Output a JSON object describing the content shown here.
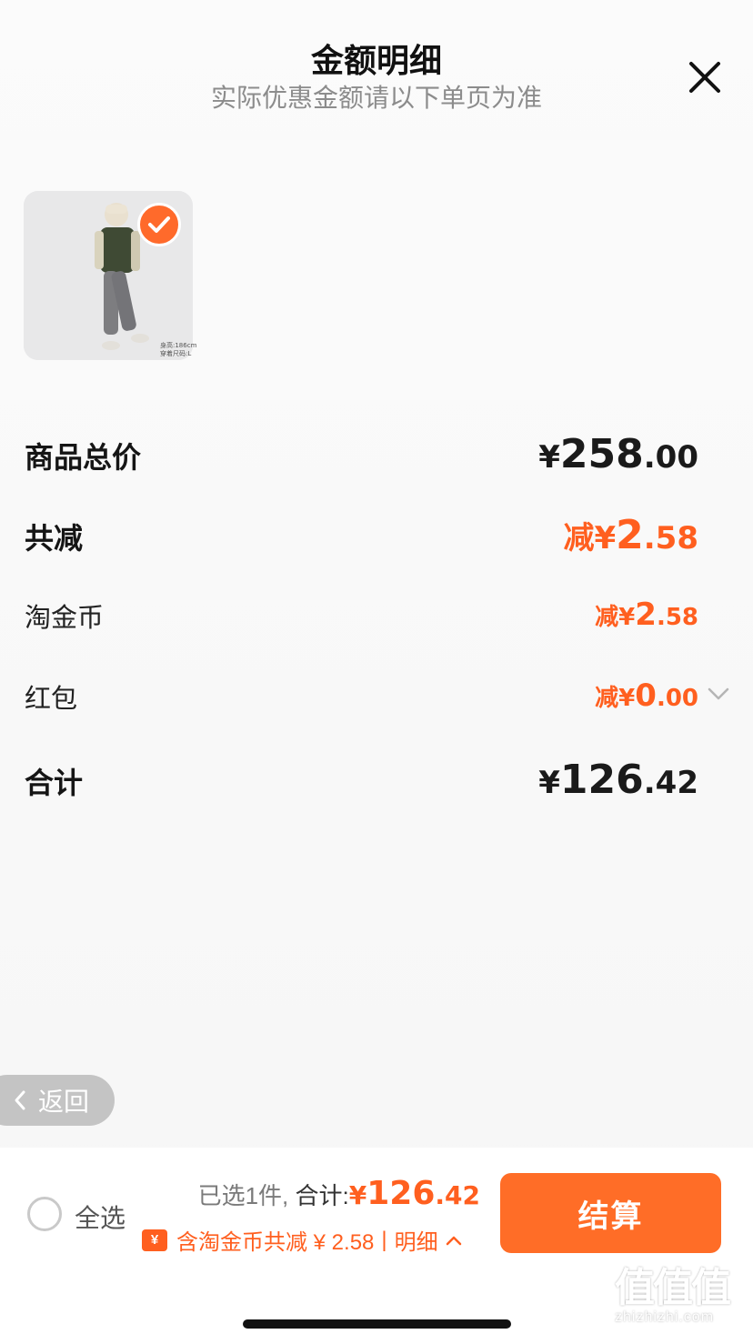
{
  "header": {
    "title": "金额明细",
    "subtitle": "实际优惠金额请以下单页为准"
  },
  "product": {
    "caption_line1": "身高:186cm",
    "caption_line2": "穿着尺码:L"
  },
  "rows": {
    "total_price": {
      "label": "商品总价",
      "yen": "¥",
      "int": "258",
      "dec": ".00"
    },
    "total_discount": {
      "label": "共减",
      "prefix": "减",
      "yen": "¥",
      "int": "2",
      "dec": ".58"
    },
    "taojinbi": {
      "label": "淘金币",
      "prefix": "减",
      "yen": "¥",
      "int": "2",
      "dec": ".58"
    },
    "red_packet": {
      "label": "红包",
      "prefix": "减",
      "yen": "¥",
      "int": "0",
      "dec": ".00"
    },
    "sum": {
      "label": "合计",
      "yen": "¥",
      "int": "126",
      "dec": ".42"
    }
  },
  "back_button": {
    "label": "返回"
  },
  "bottom_bar": {
    "select_all": "全选",
    "selected_text": "已选1件,",
    "total_label": "合计:",
    "total_yen": "¥",
    "total_int": "126",
    "total_dec": ".42",
    "coin_icon_text": "¥",
    "discount_text": "含淘金币共减 ¥ 2.58",
    "detail_text": "明细",
    "checkout_label": "结算"
  },
  "watermark": {
    "big": "值值值",
    "small": "zhizhizhi.com"
  },
  "colors": {
    "accent": "#ff5f1f",
    "button": "#ff6d27",
    "muted": "#8c8c8c"
  }
}
